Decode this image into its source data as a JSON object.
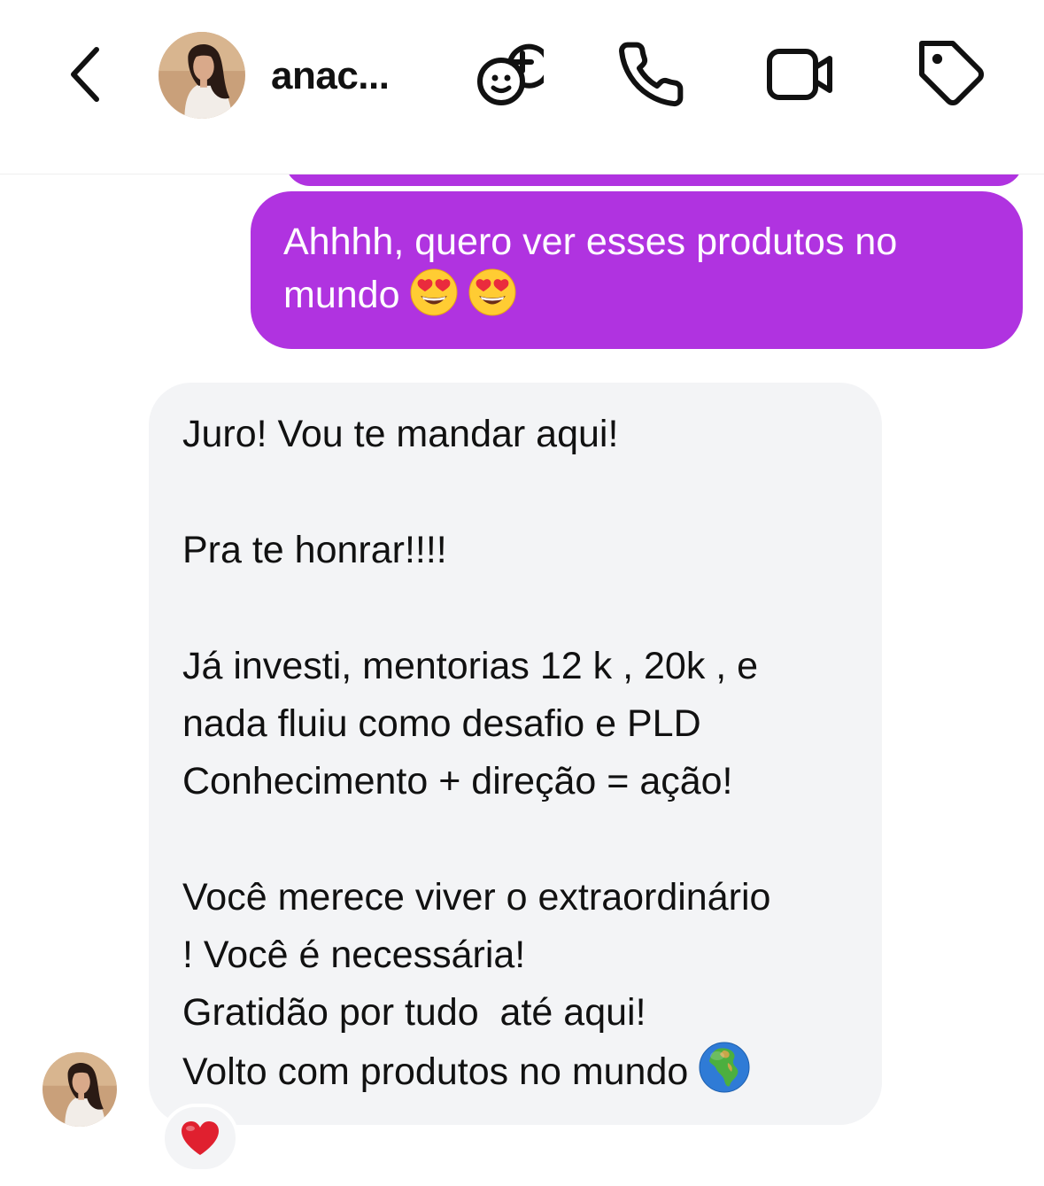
{
  "header": {
    "contact_name": "anac...",
    "icons": {
      "back": "chevron-left-icon",
      "add_member": "add-person-icon",
      "call": "phone-icon",
      "video": "video-camera-icon",
      "label": "tag-icon"
    }
  },
  "messages": [
    {
      "direction": "outgoing",
      "lines": [
        "Ahhhh, quero ver esses produtos no",
        "mundo"
      ],
      "emojis": [
        "heart-eyes-emoji",
        "heart-eyes-emoji"
      ]
    },
    {
      "direction": "incoming",
      "lines": [
        "Juro! Vou te mandar aqui!",
        "",
        "Pra te honrar!!!!",
        "",
        "Já investi, mentorias 12 k , 20k , e",
        "nada fluiu como desafio e PLD",
        "Conhecimento + direção = ação!",
        "",
        "Você merece viver o extraordinário",
        "! Você é necessária!",
        "Gratidão por tudo  até aqui!",
        "Volto com produtos no mundo"
      ],
      "emojis": [
        "globe-africa-emoji"
      ],
      "reaction": "heart-emoji"
    }
  ],
  "colors": {
    "outgoing_bubble": "#b033e0",
    "incoming_bubble": "#f3f4f6",
    "header_bg": "#ffffff"
  }
}
